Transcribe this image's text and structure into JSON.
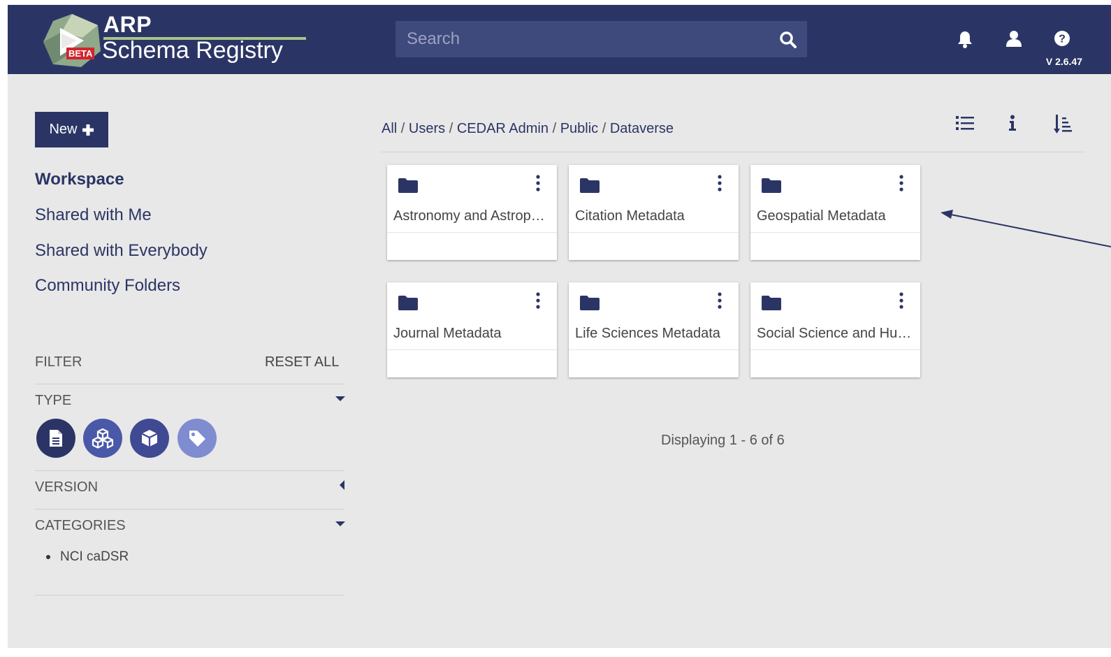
{
  "header": {
    "logo_acronym": "ARP",
    "logo_badge": "BETA",
    "logo_name": "Schema Registry",
    "search_placeholder": "Search",
    "search_value": "",
    "version": "V 2.6.47",
    "icons": [
      "bell-icon",
      "user-icon",
      "help-icon"
    ]
  },
  "sidebar": {
    "new_label": "New",
    "nav": [
      {
        "label": "Workspace",
        "active": true
      },
      {
        "label": "Shared with Me",
        "active": false
      },
      {
        "label": "Shared with Everybody",
        "active": false
      },
      {
        "label": "Community Folders",
        "active": false
      }
    ],
    "filter_label": "FILTER",
    "reset_label": "RESET ALL",
    "type_label": "TYPE",
    "type_buttons": [
      "template-icon",
      "element-icon",
      "field-icon",
      "instance-icon"
    ],
    "version_label": "VERSION",
    "categories_label": "CATEGORIES",
    "categories": [
      "NCI caDSR"
    ]
  },
  "main": {
    "breadcrumb": [
      "All",
      "Users",
      "CEDAR Admin",
      "Public",
      "Dataverse"
    ],
    "toolbar_icons": [
      "list-view-icon",
      "info-icon",
      "sort-icon"
    ],
    "folders": [
      "Astronomy and Astrophysics Metadata",
      "Citation Metadata",
      "Geospatial Metadata",
      "Journal Metadata",
      "Life Sciences Metadata",
      "Social Science and Humanities Metadata"
    ],
    "displaying": "Displaying 1 - 6 of 6"
  },
  "colors": {
    "brand": "#2b3565",
    "search_bg": "#3f4a7c",
    "background": "#e8e8e8",
    "beta": "#d3252e",
    "type_active": "#2b3565",
    "type_mid": "#4a58a8",
    "type_light": "#7f8cd0"
  }
}
